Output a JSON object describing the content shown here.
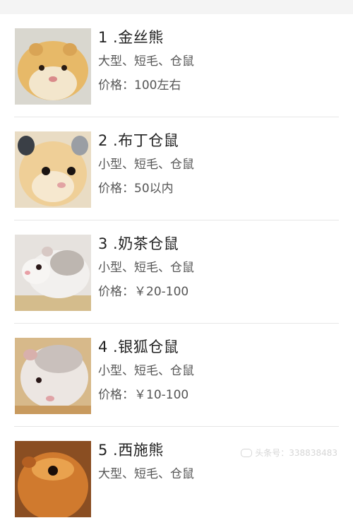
{
  "items": [
    {
      "title": "1 .金丝熊",
      "tags": "大型、短毛、仓鼠",
      "price": "价格：100左右",
      "image": "golden-hamster"
    },
    {
      "title": "2 .布丁仓鼠",
      "tags": "小型、短毛、仓鼠",
      "price": "价格：50以内",
      "image": "pudding-hamster"
    },
    {
      "title": "3 .奶茶仓鼠",
      "tags": "小型、短毛、仓鼠",
      "price": "价格：￥20-100",
      "image": "milk-tea-hamster"
    },
    {
      "title": "4 .银狐仓鼠",
      "tags": "小型、短毛、仓鼠",
      "price": "价格：￥10-100",
      "image": "silver-fox-hamster"
    },
    {
      "title": "5 .西施熊",
      "tags": "大型、短毛、仓鼠",
      "price": "",
      "image": "teddy-hamster"
    }
  ],
  "watermark": "头条号：338838483"
}
